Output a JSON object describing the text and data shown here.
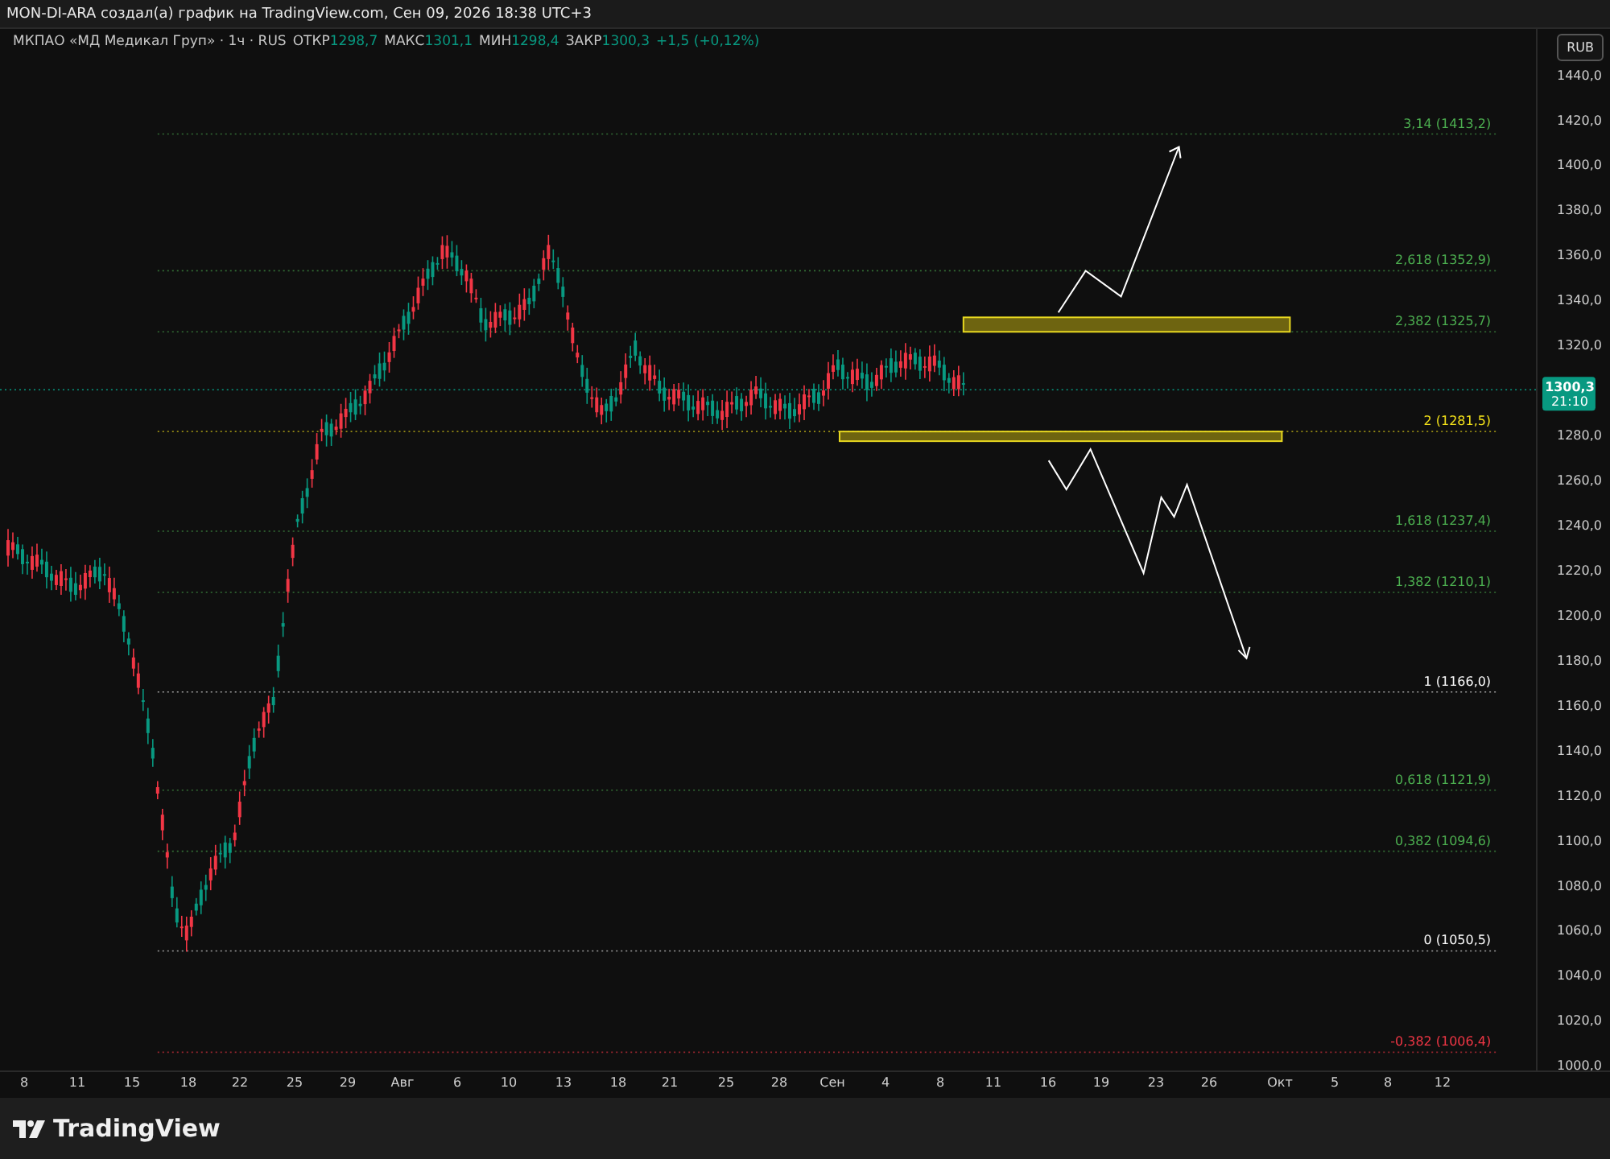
{
  "header": {
    "title": "MON-DI-ARA создал(а) график на TradingView.com, Сен 09, 2026 18:38 UTC+3"
  },
  "legend": {
    "symbol": "МКПАО «МД Медикал Груп» · 1ч · RUS",
    "ohlc": [
      {
        "label": "ОТКР",
        "value": "1298,7"
      },
      {
        "label": "МАКС",
        "value": "1301,1"
      },
      {
        "label": "МИН",
        "value": "1298,4"
      },
      {
        "label": "ЗАКР",
        "value": "1300,3"
      }
    ],
    "change": "+1,5 (+0,12%)"
  },
  "price_axis": {
    "currency": "RUB",
    "ticks": [
      "1440,0",
      "1420,0",
      "1400,0",
      "1380,0",
      "1360,0",
      "1340,0",
      "1320,0",
      "1280,0",
      "1260,0",
      "1240,0",
      "1220,0",
      "1200,0",
      "1180,0",
      "1160,0",
      "1140,0",
      "1120,0",
      "1100,0",
      "1080,0",
      "1060,0",
      "1040,0",
      "1020,0",
      "1000,0"
    ],
    "last_price": {
      "price": "1300,3",
      "countdown": "21:10"
    }
  },
  "fib_levels": [
    {
      "label": "3,14 (1413,2)",
      "color": "#4caf50"
    },
    {
      "label": "2,618 (1352,9)",
      "color": "#4caf50"
    },
    {
      "label": "2,382 (1325,7)",
      "color": "#4caf50"
    },
    {
      "label": "2 (1281,5)",
      "color": "#f2e019"
    },
    {
      "label": "1,618 (1237,4)",
      "color": "#4caf50"
    },
    {
      "label": "1,382 (1210,1)",
      "color": "#4caf50"
    },
    {
      "label": "1 (1166,0)",
      "color": "#ffffff"
    },
    {
      "label": "0,618 (1121,9)",
      "color": "#4caf50"
    },
    {
      "label": "0,382 (1094,6)",
      "color": "#4caf50"
    },
    {
      "label": "0 (1050,5)",
      "color": "#ffffff"
    },
    {
      "label": "-0,382 (1006,4)",
      "color": "#f23645"
    }
  ],
  "time_axis": [
    "8",
    "11",
    "15",
    "18",
    "22",
    "25",
    "29",
    "Авг",
    "6",
    "10",
    "13",
    "18",
    "21",
    "25",
    "28",
    "Сен",
    "4",
    "8",
    "11",
    "16",
    "19",
    "23",
    "26",
    "Окт",
    "5",
    "8",
    "12"
  ],
  "footer": {
    "logo": "TradingView"
  }
}
